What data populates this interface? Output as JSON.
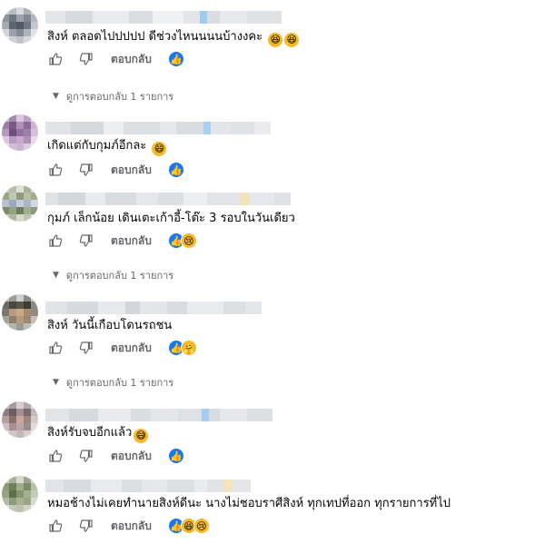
{
  "labels": {
    "reply": "ตอบกลับ",
    "view_replies": "ดูการตอบกลับ 1 รายการ"
  },
  "comments": [
    {
      "text": "สิงห์ ตลอดไปปปปป ดีช่วงไหนนนนบ้างงคะ",
      "trailing_emojis": [
        "😆",
        "😆"
      ],
      "reactions": [
        "like"
      ],
      "has_replies": true
    },
    {
      "text": "เกิดแต่กับกุมภ์อีกละ",
      "trailing_emojis": [
        "😄"
      ],
      "reactions": [
        "like"
      ],
      "has_replies": false
    },
    {
      "text": "กุมภ์ เล็กน้อย เดินเตะเก้าอี้-โต๊ะ 3 รอบในวันเดียว",
      "trailing_emojis": [],
      "reactions": [
        "like",
        "sad"
      ],
      "has_replies": true
    },
    {
      "text": "สิงห์ วันนี้เกือบโดนรถชน",
      "trailing_emojis": [],
      "reactions": [
        "like",
        "care"
      ],
      "has_replies": true
    },
    {
      "text": "สิงห์รับจบอีกแล้ว",
      "trailing_emojis": [
        "😅"
      ],
      "reactions": [
        "like"
      ],
      "has_replies": false
    },
    {
      "text": "หมอช้างไม่เคยทำนายสิงห์ดีนะ นางไม่ชอบราศีสิงห์ ทุกเทปที่ออก ทุกรายการที่ไป",
      "trailing_emojis": [],
      "reactions": [
        "like",
        "haha",
        "sad"
      ],
      "has_replies": false
    }
  ],
  "colors": {
    "like": "#1877f2",
    "secondary_text": "#65676b",
    "blur": "#dfe1e5"
  }
}
